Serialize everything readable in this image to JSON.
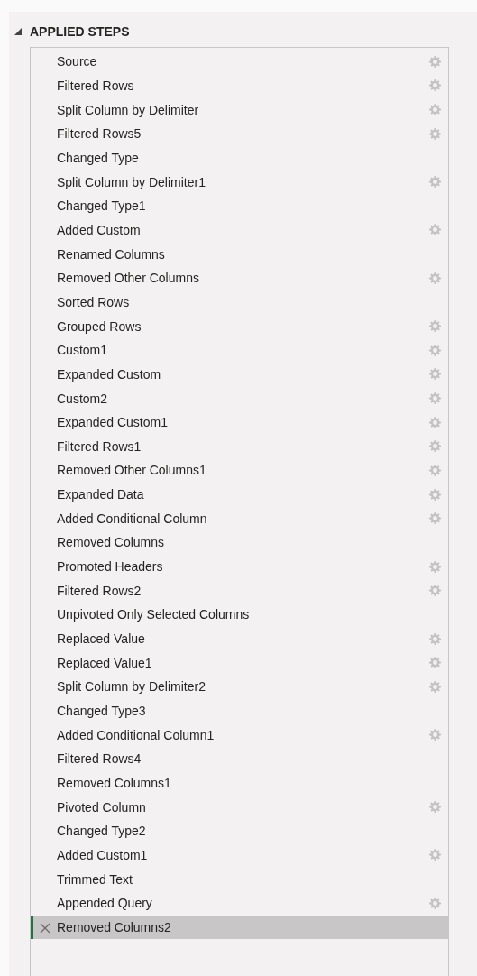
{
  "panel": {
    "title": "APPLIED STEPS",
    "expanded": true
  },
  "steps": [
    {
      "label": "Source",
      "has_settings": true,
      "selected": false
    },
    {
      "label": "Filtered Rows",
      "has_settings": true,
      "selected": false
    },
    {
      "label": "Split Column by Delimiter",
      "has_settings": true,
      "selected": false
    },
    {
      "label": "Filtered Rows5",
      "has_settings": true,
      "selected": false
    },
    {
      "label": "Changed Type",
      "has_settings": false,
      "selected": false
    },
    {
      "label": "Split Column by Delimiter1",
      "has_settings": true,
      "selected": false
    },
    {
      "label": "Changed Type1",
      "has_settings": false,
      "selected": false
    },
    {
      "label": "Added Custom",
      "has_settings": true,
      "selected": false
    },
    {
      "label": "Renamed Columns",
      "has_settings": false,
      "selected": false
    },
    {
      "label": "Removed Other Columns",
      "has_settings": true,
      "selected": false
    },
    {
      "label": "Sorted Rows",
      "has_settings": false,
      "selected": false
    },
    {
      "label": "Grouped Rows",
      "has_settings": true,
      "selected": false
    },
    {
      "label": "Custom1",
      "has_settings": true,
      "selected": false
    },
    {
      "label": "Expanded Custom",
      "has_settings": true,
      "selected": false
    },
    {
      "label": "Custom2",
      "has_settings": true,
      "selected": false
    },
    {
      "label": "Expanded Custom1",
      "has_settings": true,
      "selected": false
    },
    {
      "label": "Filtered Rows1",
      "has_settings": true,
      "selected": false
    },
    {
      "label": "Removed Other Columns1",
      "has_settings": true,
      "selected": false
    },
    {
      "label": "Expanded Data",
      "has_settings": true,
      "selected": false
    },
    {
      "label": "Added Conditional Column",
      "has_settings": true,
      "selected": false
    },
    {
      "label": "Removed Columns",
      "has_settings": false,
      "selected": false
    },
    {
      "label": "Promoted Headers",
      "has_settings": true,
      "selected": false
    },
    {
      "label": "Filtered Rows2",
      "has_settings": true,
      "selected": false
    },
    {
      "label": "Unpivoted Only Selected Columns",
      "has_settings": false,
      "selected": false
    },
    {
      "label": "Replaced Value",
      "has_settings": true,
      "selected": false
    },
    {
      "label": "Replaced Value1",
      "has_settings": true,
      "selected": false
    },
    {
      "label": "Split Column by Delimiter2",
      "has_settings": true,
      "selected": false
    },
    {
      "label": "Changed Type3",
      "has_settings": false,
      "selected": false
    },
    {
      "label": "Added Conditional Column1",
      "has_settings": true,
      "selected": false
    },
    {
      "label": "Filtered Rows4",
      "has_settings": false,
      "selected": false
    },
    {
      "label": "Removed Columns1",
      "has_settings": false,
      "selected": false
    },
    {
      "label": "Pivoted Column",
      "has_settings": true,
      "selected": false
    },
    {
      "label": "Changed Type2",
      "has_settings": false,
      "selected": false
    },
    {
      "label": "Added Custom1",
      "has_settings": true,
      "selected": false
    },
    {
      "label": "Trimmed Text",
      "has_settings": false,
      "selected": false
    },
    {
      "label": "Appended Query",
      "has_settings": true,
      "selected": false
    },
    {
      "label": "Removed Columns2",
      "has_settings": false,
      "selected": true
    }
  ]
}
